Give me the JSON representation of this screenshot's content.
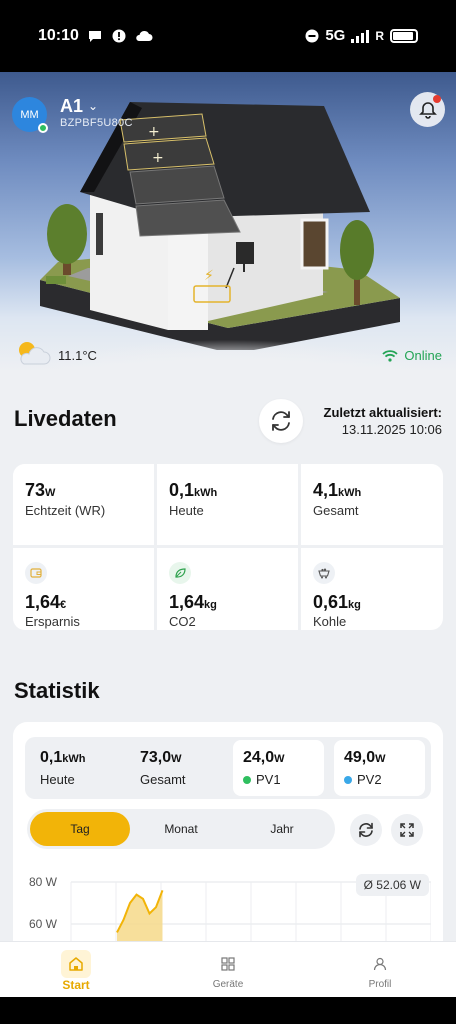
{
  "status_bar": {
    "time": "10:10",
    "network": "5G",
    "signal": "R"
  },
  "header": {
    "avatar_initials": "MM",
    "device_name": "A1",
    "device_id": "BZPBF5U80C"
  },
  "weather": {
    "temperature": "11.1°C",
    "connection": "Online",
    "icon": "partly-sunny-icon"
  },
  "live": {
    "title": "Livedaten",
    "updated_label": "Zuletzt aktualisiert:",
    "updated_time": "13.11.2025 10:06",
    "metrics": [
      {
        "value": "73",
        "unit": "W",
        "label": "Echtzeit (WR)"
      },
      {
        "value": "0,1",
        "unit": "kWh",
        "label": "Heute"
      },
      {
        "value": "4,1",
        "unit": "kWh",
        "label": "Gesamt"
      },
      {
        "value": "1,64",
        "unit": "€",
        "label": "Ersparnis",
        "icon": "wallet-icon"
      },
      {
        "value": "1,64",
        "unit": "kg",
        "label": "CO2",
        "icon": "leaf-icon"
      },
      {
        "value": "0,61",
        "unit": "kg",
        "label": "Kohle",
        "icon": "coal-cart-icon"
      }
    ]
  },
  "statistics": {
    "title": "Statistik",
    "today_value": "0,1",
    "today_unit": "kWh",
    "today_label": "Heute",
    "total_value": "73,0",
    "total_unit": "W",
    "total_label": "Gesamt",
    "pv1_value": "24,0",
    "pv1_unit": "W",
    "pv1_label": "PV1",
    "pv2_value": "49,0",
    "pv2_unit": "W",
    "pv2_label": "PV2",
    "periods": [
      "Tag",
      "Monat",
      "Jahr"
    ],
    "active_period": "Tag",
    "average": "Ø 52.06 W"
  },
  "colors": {
    "accent": "#f2b408",
    "online": "#23a455",
    "pv1": "#2fbf5f",
    "pv2": "#3aa8e8",
    "avatar": "#2d86de"
  },
  "chart_data": {
    "type": "area",
    "ylabel_ticks": [
      "80 W",
      "60 W"
    ],
    "ylim": [
      60,
      80
    ],
    "series": [
      {
        "values": [
          56,
          62,
          70,
          74,
          72,
          65,
          68,
          76
        ]
      }
    ],
    "grid": true
  },
  "tabbar": {
    "tabs": [
      "Start",
      "Geräte",
      "Profil"
    ],
    "active": "Start"
  }
}
